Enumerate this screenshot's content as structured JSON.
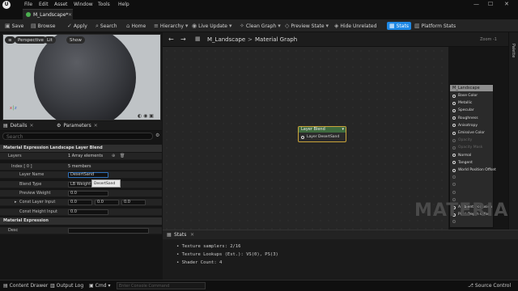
{
  "menu": [
    "File",
    "Edit",
    "Asset",
    "Window",
    "Tools",
    "Help"
  ],
  "tab": {
    "title": "M_Landscape*"
  },
  "toolbar": {
    "save": "Save",
    "browse": "Browse",
    "apply": "Apply",
    "search": "Search",
    "home": "Home",
    "hierarchy": "Hierarchy",
    "live_update": "Live Update",
    "clean_graph": "Clean Graph",
    "preview_state": "Preview State",
    "hide_unrelated": "Hide Unrelated",
    "stats": "Stats",
    "platform_stats": "Platform Stats"
  },
  "viewport": {
    "perspective": "Perspective",
    "lit": "Lit",
    "show": "Show"
  },
  "details": {
    "tab_details": "Details",
    "tab_parameters": "Parameters",
    "search_placeholder": "Search",
    "section1": "Material Expression Landscape Layer Blend",
    "layers_label": "Layers",
    "layers_value": "1 Array elements",
    "index_label": "Index [ 0 ]",
    "index_value": "5 members",
    "layer_name_label": "Layer Name",
    "layer_name_value": "DesertSand",
    "blend_type_label": "Blend Type",
    "blend_type_value": "LB Weight Blend",
    "preview_weight_label": "Preview Weight",
    "preview_weight_value": "0.0",
    "const_layer_label": "Const Layer Input",
    "const_layer_x": "0.0",
    "const_layer_y": "0.0",
    "const_layer_z": "0.0",
    "const_height_label": "Const Height Input",
    "const_height_value": "0.0",
    "section2": "Material Expression",
    "desc_label": "Desc",
    "tooltip": "DesertSand"
  },
  "graph": {
    "breadcrumb_asset": "M_Landscape",
    "breadcrumb_sep": ">",
    "breadcrumb_graph": "Material Graph",
    "zoom": "Zoom -1",
    "watermark": "MATERIAL",
    "result_node": {
      "title": "M_Landscape",
      "pins": [
        "Base Color",
        "Metallic",
        "Specular",
        "Roughness",
        "Anisotropy",
        "Emissive Color",
        "Opacity",
        "Opacity Mask",
        "Normal",
        "Tangent",
        "World Position Offset",
        "",
        "",
        "",
        "",
        "Ambient Occlusion",
        "Pixel Depth Offset",
        ""
      ],
      "dim_pins": [
        6,
        7,
        11,
        12,
        13,
        14,
        17
      ]
    },
    "blend_node": {
      "title": "Layer Blend",
      "pin": "Layer DesertSand"
    }
  },
  "palette": {
    "label": "Palette"
  },
  "stats": {
    "title": "Stats",
    "lines": [
      "Texture samplers: 2/16",
      "Texture Lookups (Est.): VS(0), PS(3)",
      "Shader Count: 4"
    ]
  },
  "statusbar": {
    "content_drawer": "Content Drawer",
    "output_log": "Output Log",
    "cmd": "Cmd",
    "console_placeholder": "Enter Console Command",
    "source_control": "Source Control"
  }
}
